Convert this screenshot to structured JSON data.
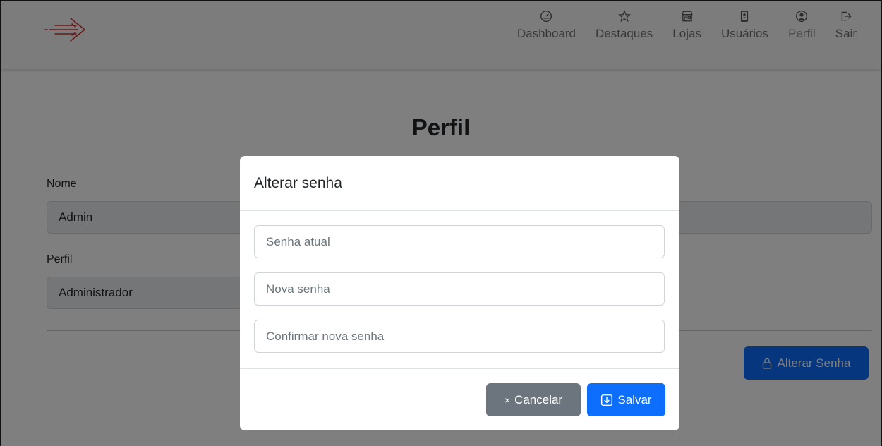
{
  "nav": {
    "items": [
      {
        "label": "Dashboard",
        "icon": "speedometer-icon"
      },
      {
        "label": "Destaques",
        "icon": "star-icon"
      },
      {
        "label": "Lojas",
        "icon": "shop-icon"
      },
      {
        "label": "Usuários",
        "icon": "phone-user-icon"
      },
      {
        "label": "Perfil",
        "icon": "person-circle-icon"
      },
      {
        "label": "Sair",
        "icon": "logout-icon"
      }
    ],
    "active": "Perfil"
  },
  "page": {
    "title": "Perfil",
    "fields": {
      "nome_label": "Nome",
      "nome_value": "Admin",
      "perfil_label": "Perfil",
      "perfil_value": "Administrador"
    },
    "change_password_button": "Alterar Senha"
  },
  "modal": {
    "title": "Alterar senha",
    "current_password_placeholder": "Senha atual",
    "new_password_placeholder": "Nova senha",
    "confirm_password_placeholder": "Confirmar nova senha",
    "cancel_label": "Cancelar",
    "save_label": "Salvar"
  },
  "colors": {
    "primary": "#0d6efd",
    "secondary": "#6c757d",
    "logo": "#d32f2f"
  }
}
